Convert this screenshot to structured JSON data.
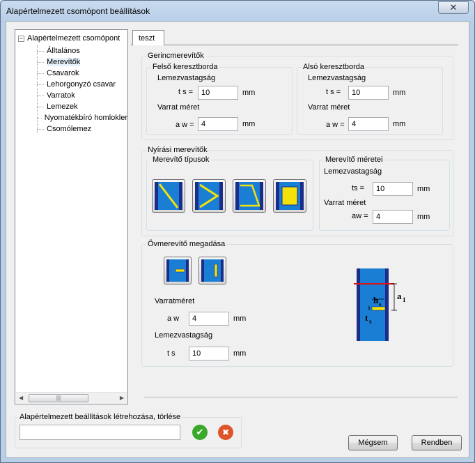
{
  "window": {
    "title": "Alapértelmezett csomópont beállítások",
    "close_glyph": "✕"
  },
  "tree": {
    "root_label": "Alapértelmezett csomópont",
    "toggle_glyph": "−",
    "items": [
      {
        "label": "Álltalános"
      },
      {
        "label": "Merevítők"
      },
      {
        "label": "Csavarok"
      },
      {
        "label": "Lehorgonyzó csavar"
      },
      {
        "label": "Varratok"
      },
      {
        "label": "Lemezek"
      },
      {
        "label": "Nyomatékbíró homlokler"
      },
      {
        "label": "Csomólemez"
      }
    ],
    "selected_index": 1,
    "scroll": {
      "left_arrow": "◀",
      "right_arrow": "▶",
      "thumb_grip": "|||"
    }
  },
  "tabs": [
    {
      "label": "teszt"
    }
  ],
  "web": {
    "title": "Gerincmerevítők",
    "upper": {
      "title": "Felső keresztborda",
      "thickness_label": "Lemezvastagság",
      "ts_label": "t s =",
      "ts_value": "10",
      "ts_unit": "mm",
      "weld_label": "Varrat méret",
      "aw_label": "a w =",
      "aw_value": "4",
      "aw_unit": "mm"
    },
    "lower": {
      "title": "Alsó keresztborda",
      "thickness_label": "Lemezvastagság",
      "ts_label": "t s =",
      "ts_value": "10",
      "ts_unit": "mm",
      "weld_label": "Varrat méret",
      "aw_label": "a w =",
      "aw_value": "4",
      "aw_unit": "mm"
    }
  },
  "shear": {
    "title": "Nyírási merevítők",
    "types_title": "Merevítő típusok",
    "types": [
      {
        "icon": "diagonal-stiffener-icon"
      },
      {
        "icon": "k-stiffener-icon"
      },
      {
        "icon": "trapezoid-stiffener-icon"
      },
      {
        "icon": "plate-stiffener-icon"
      }
    ],
    "dims": {
      "title": "Merevítő méretei",
      "thickness_label": "Lemezvastagság",
      "ts_label": "ts =",
      "ts_value": "10",
      "ts_unit": "mm",
      "weld_label": "Varrat méret",
      "aw_label": "aw =",
      "aw_value": "4",
      "aw_unit": "mm"
    }
  },
  "flange": {
    "title": "Övmerevítő megadása",
    "types": [
      {
        "icon": "horizontal-flange-stiffener-icon"
      },
      {
        "icon": "vertical-flange-stiffener-icon"
      }
    ],
    "weld_label": "Varratméret",
    "aw_label": "a w",
    "aw_value": "4",
    "aw_unit": "mm",
    "thickness_label": "Lemezvastagság",
    "ts_label": "t s",
    "ts_value": "10",
    "ts_unit": "mm",
    "diagram": {
      "h_label": "h",
      "h_sub": "s",
      "t_label": "t",
      "t_sub": "s",
      "a_label": "a",
      "a_sub": "1"
    }
  },
  "defaults": {
    "title": "Alapértelmezett beállítások létrehozása, törlése",
    "input_value": "",
    "ok_glyph": "✔",
    "delete_glyph": "✖"
  },
  "buttons": {
    "cancel": "Mégsem",
    "ok": "Rendben"
  },
  "colors": {
    "steel_blue": "#1a7fd4",
    "flange_dark": "#1b2c8a",
    "weld_yellow": "#f2e20a",
    "ok_green": "#3aa82a",
    "delete_red": "#e0542a"
  }
}
